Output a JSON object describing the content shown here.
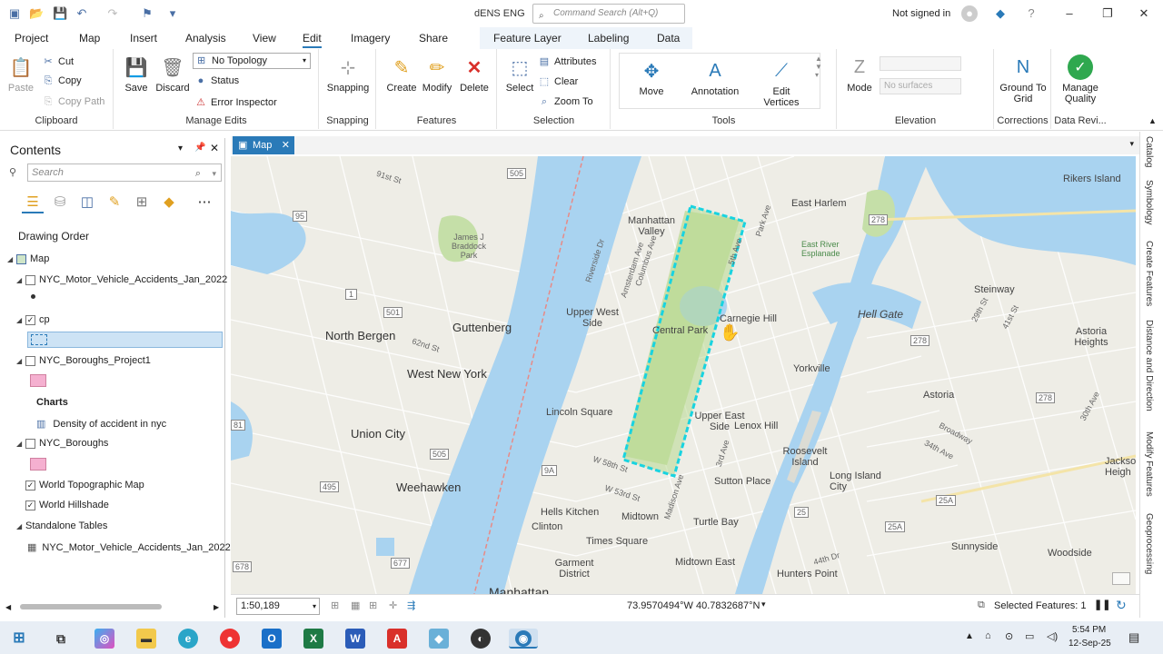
{
  "app": {
    "title": "dENS ENG",
    "command_search_placeholder": "Command Search (Alt+Q)",
    "signin": "Not signed in"
  },
  "tabs": [
    "Project",
    "Map",
    "Insert",
    "Analysis",
    "View",
    "Edit",
    "Imagery",
    "Share",
    "Feature Layer",
    "Labeling",
    "Data"
  ],
  "active_tab": "Edit",
  "ribbon": {
    "clipboard": {
      "paste": "Paste",
      "cut": "Cut",
      "copy": "Copy",
      "copy_path": "Copy Path",
      "label": "Clipboard"
    },
    "manage_edits": {
      "save": "Save",
      "discard": "Discard",
      "topology": "No Topology",
      "status": "Status",
      "error_inspector": "Error Inspector",
      "label": "Manage Edits"
    },
    "snapping": {
      "snapping": "Snapping",
      "label": "Snapping"
    },
    "features": {
      "create": "Create",
      "modify": "Modify",
      "delete": "Delete",
      "label": "Features"
    },
    "selection": {
      "select": "Select",
      "attributes": "Attributes",
      "clear": "Clear",
      "zoom_to": "Zoom To",
      "label": "Selection"
    },
    "tools": {
      "move": "Move",
      "annotation": "Annotation",
      "edit_vertices": "Edit Vertices",
      "label": "Tools"
    },
    "elevation": {
      "mode": "Mode",
      "surfaces": "No surfaces",
      "label": "Elevation"
    },
    "corrections": {
      "ground_to_grid": "Ground To Grid",
      "label": "Corrections"
    },
    "data_review": {
      "manage_quality": "Manage Quality",
      "label": "Data Revi..."
    }
  },
  "contents": {
    "title": "Contents",
    "search_placeholder": "Search",
    "drawing_order": "Drawing Order",
    "map": "Map",
    "layers": [
      {
        "name": "NYC_Motor_Vehicle_Accidents_Jan_2022",
        "checked": false
      },
      {
        "name": "cp",
        "checked": true
      },
      {
        "name": "NYC_Boroughs_Project1",
        "checked": false
      },
      {
        "name": "NYC_Boroughs",
        "checked": false
      },
      {
        "name": "World Topographic Map",
        "checked": true
      },
      {
        "name": "World Hillshade",
        "checked": true
      }
    ],
    "charts_label": "Charts",
    "chart_item": "Density of accident in nyc",
    "standalone_tables": "Standalone Tables",
    "table_item": "NYC_Motor_Vehicle_Accidents_Jan_2022"
  },
  "map": {
    "tab": "Map",
    "labels": {
      "north_bergen": "North Bergen",
      "guttenberg": "Guttenberg",
      "west_new_york": "West New York",
      "union_city": "Union City",
      "weehawken": "Weehawken",
      "manhattan_valley": "Manhattan Valley",
      "upper_west_side": "Upper West Side",
      "central_park": "Central Park",
      "carnegie_hill": "Carnegie Hill",
      "east_harlem": "East Harlem",
      "yorkville": "Yorkville",
      "upper_east_side": "Upper East Side",
      "lenox_hill": "Lenox Hill",
      "lincoln_square": "Lincoln Square",
      "hells_kitchen": "Hells Kitchen",
      "clinton": "Clinton",
      "midtown": "Midtown",
      "times_square": "Times Square",
      "garment_district": "Garment District",
      "turtle_bay": "Turtle Bay",
      "sutton_place": "Sutton Place",
      "midtown_east": "Midtown East",
      "roosevelt_island": "Roosevelt Island",
      "long_island_city": "Long Island City",
      "hunters_point": "Hunters Point",
      "astoria": "Astoria",
      "steinway": "Steinway",
      "hell_gate": "Hell Gate",
      "astoria_heights": "Astoria Heights",
      "rikers_island": "Rikers Island",
      "sunnyside": "Sunnyside",
      "woodside": "Woodside",
      "jackson_heights": "Jackso Heigh",
      "manhattan": "Manhattan",
      "james_braddock": "James J Braddock Park",
      "east_river_esplanade": "East River Esplanade",
      "st_91": "91st St",
      "st_62": "62nd St",
      "w_58": "W 58th St",
      "w_53": "W 53rd St",
      "st_44": "44th Dr",
      "broadway": "Broadway",
      "ave_34": "34th Ave",
      "ave_30": "30th Ave",
      "st_29": "29th St",
      "st_41": "41st St",
      "park_ave": "Park Ave",
      "madison_ave": "Madison Ave",
      "third_ave": "3rd Ave",
      "amsterdam_ave": "Amsterdam Ave",
      "columbus_ave": "Columbus Ave",
      "riverside_dr": "Riverside Dr",
      "fifth_ave": "5th Ave"
    },
    "shields": [
      "505",
      "95",
      "1",
      "501",
      "278",
      "278",
      "505",
      "9A",
      "495",
      "677",
      "25A",
      "25A",
      "25",
      "278",
      "678",
      "81"
    ]
  },
  "status": {
    "scale": "1:50,189",
    "coords": "73.9570494°W 40.7832687°N",
    "selected": "Selected Features: 1"
  },
  "right_dock": [
    "Catalog",
    "Symbology",
    "Create Features",
    "Distance and Direction",
    "Modify Features",
    "Geoprocessing"
  ],
  "taskbar": {
    "time": "5:54 PM",
    "date": "12-Sep-25"
  }
}
